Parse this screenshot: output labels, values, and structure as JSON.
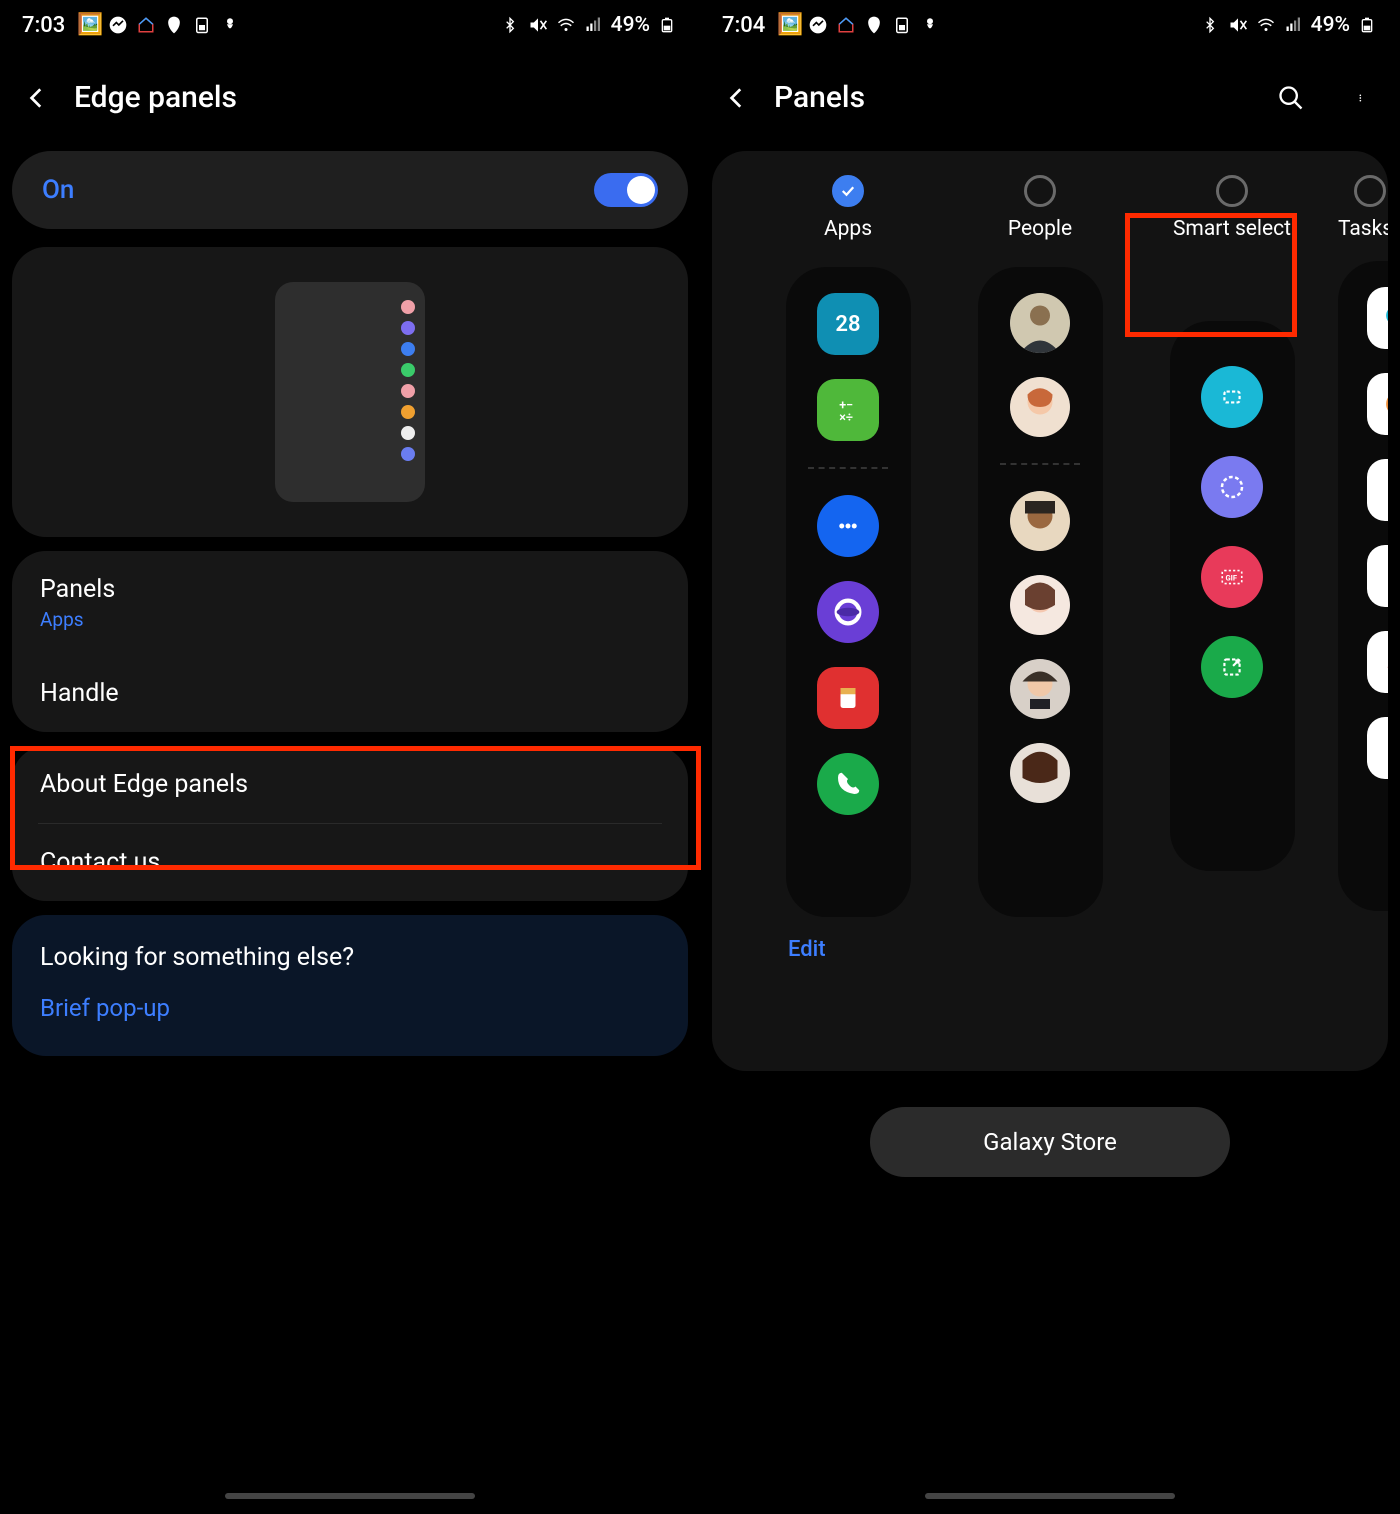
{
  "left": {
    "status": {
      "time": "7:03",
      "battery": "49%"
    },
    "header": {
      "title": "Edge panels"
    },
    "toggle_label": "On",
    "menu": {
      "panels": {
        "label": "Panels",
        "sub": "Apps"
      },
      "handle": {
        "label": "Handle"
      },
      "about": {
        "label": "About Edge panels"
      },
      "contact": {
        "label": "Contact us"
      }
    },
    "suggest": {
      "title": "Looking for something else?",
      "link": "Brief pop-up"
    }
  },
  "right": {
    "status": {
      "time": "7:04",
      "battery": "49%"
    },
    "header": {
      "title": "Panels"
    },
    "panels": {
      "apps": "Apps",
      "people": "People",
      "smart": "Smart select",
      "tasks": "Tasks"
    },
    "apps_panel": {
      "calendar_day": "28"
    },
    "edit": "Edit",
    "store": "Galaxy Store"
  }
}
